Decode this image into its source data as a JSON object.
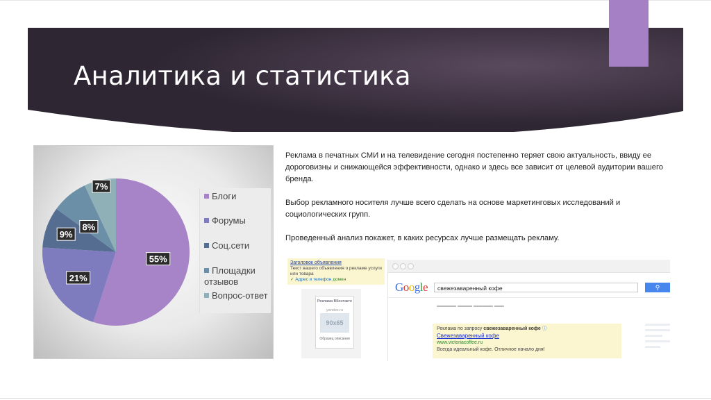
{
  "slide": {
    "title": "Аналитика и статистика",
    "accent_color": "#a680c4",
    "banner_color": "#3a2f3d"
  },
  "chart_data": {
    "type": "pie",
    "categories": [
      "Блоги",
      "Форумы",
      "Соц.сети",
      "Площадки отзывов",
      "Вопрос-ответ"
    ],
    "values": [
      55,
      21,
      9,
      8,
      7
    ],
    "data_labels": [
      "55%",
      "21%",
      "9%",
      "8%",
      "7%"
    ],
    "colors": [
      "#a784c7",
      "#7e7bbf",
      "#566d92",
      "#6c8fa8",
      "#8fb0b6"
    ],
    "legend": {
      "position": "right",
      "items": [
        "Блоги",
        "Форумы",
        "Соц.сети",
        "Площадки отзывов",
        "Вопрос-ответ"
      ]
    }
  },
  "text": {
    "paragraphs": [
      "Реклама в печатных СМИ и на телевидение сегодня постепенно теряет свою актуальность, ввиду ее дороговизны и снижающейся эффективности, однако и здесь все зависит от целевой аудитории вашего бренда.",
      "Выбор рекламного носителя лучше всего сделать на основе маркетинговых исследований и социологических групп.",
      "Проведенный анализ покажет, в каких ресурсах лучше размещать рекламу."
    ]
  },
  "ad_example": {
    "yandex_ad": {
      "title": "Заголовок объявления",
      "body": "Текст вашего объявления о рекламе услуги или товара",
      "link": "Адрес и телефон",
      "domain": "домен"
    },
    "vk_ad": {
      "header": "Реклама ВКонтакте",
      "sub": "yandex.ru",
      "image_label": "90x65",
      "caption": "Образец описания"
    },
    "google": {
      "logo_letters": [
        "G",
        "o",
        "o",
        "g",
        "l",
        "e"
      ],
      "logo_colors": [
        "#3c6fd8",
        "#d53a2e",
        "#f1b400",
        "#3c6fd8",
        "#2e9d3e",
        "#d53a2e"
      ],
      "query": "свежезаваренный кофе",
      "ad_header_prefix": "Реклама по запросу",
      "ad_header_query": "свежезаваренный кофе",
      "ad_link": "Свежезаваренный кофе",
      "ad_domain": "www.victoriacoffee.ru",
      "ad_text": "Всегда идеальный кофе. Отличное начало дня!"
    }
  }
}
